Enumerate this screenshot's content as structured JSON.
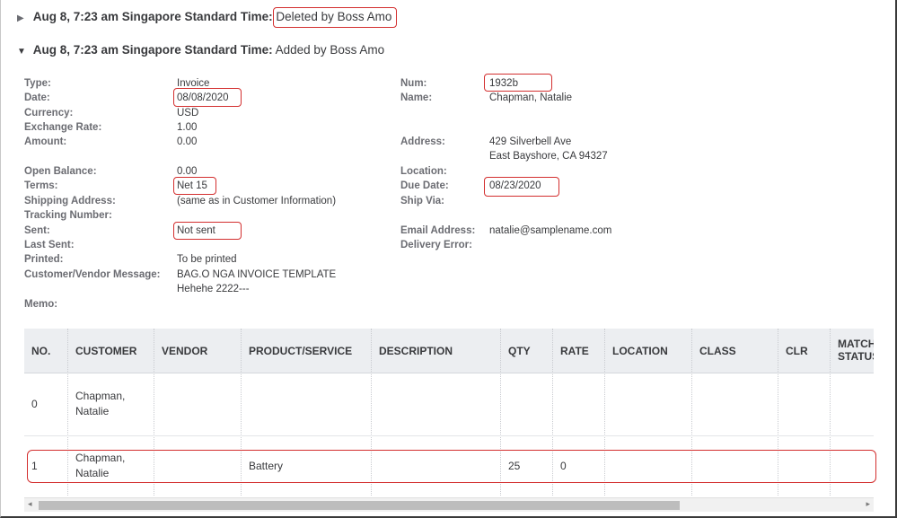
{
  "entries": [
    {
      "toggle": "▶",
      "timestamp": "Aug 8, 7:23 am Singapore Standard Time:",
      "action": "Deleted by Boss Amo"
    },
    {
      "toggle": "▼",
      "timestamp": "Aug 8, 7:23 am Singapore Standard Time:",
      "action": "Added by Boss Amo"
    }
  ],
  "details_left": [
    {
      "label": "Type:",
      "value": "Invoice"
    },
    {
      "label": "Date:",
      "value": "08/08/2020"
    },
    {
      "label": "Currency:",
      "value": "USD"
    },
    {
      "label": "Exchange Rate:",
      "value": "1.00"
    },
    {
      "label": "Amount:",
      "value": "0.00"
    },
    {
      "label": "Open Balance:",
      "value": "0.00"
    },
    {
      "label": "Terms:",
      "value": "Net 15"
    },
    {
      "label": "Shipping Address:",
      "value": "(same as in Customer Information)"
    },
    {
      "label": "Tracking Number:",
      "value": ""
    },
    {
      "label": "Sent:",
      "value": "Not sent"
    },
    {
      "label": "Last Sent:",
      "value": ""
    },
    {
      "label": "Printed:",
      "value": "To be printed"
    },
    {
      "label": "Customer/Vendor Message:",
      "value": "BAG.O NGA INVOICE TEMPLATE",
      "value2": "Hehehe 2222---"
    },
    {
      "label": "Memo:",
      "value": ""
    }
  ],
  "details_right": [
    {
      "label": "Num:",
      "value": "1932b"
    },
    {
      "label": "Name:",
      "value": "Chapman, Natalie"
    },
    {
      "label": "Address:",
      "value": "429 Silverbell Ave",
      "value2": "East Bayshore, CA  94327"
    },
    {
      "label": "Location:",
      "value": ""
    },
    {
      "label": "Due Date:",
      "value": "08/23/2020"
    },
    {
      "label": "Ship Via:",
      "value": ""
    },
    {
      "label": "Email Address:",
      "value": "natalie@samplename.com"
    },
    {
      "label": "Delivery Error:",
      "value": ""
    }
  ],
  "table": {
    "columns": [
      "NO.",
      "CUSTOMER",
      "VENDOR",
      "PRODUCT/SERVICE",
      "DESCRIPTION",
      "QTY",
      "RATE",
      "LOCATION",
      "CLASS",
      "CLR",
      "MATCH STATUS"
    ],
    "match_line1": "MATCH",
    "match_line2": "STATUS",
    "rows": [
      {
        "no": "0",
        "customer_l1": "Chapman,",
        "customer_l2": "Natalie",
        "vendor": "",
        "product": "",
        "description": "",
        "qty": "",
        "rate": "",
        "location": "",
        "class": "",
        "clr": "",
        "match": ""
      },
      {
        "no": "1",
        "customer_l1": "Chapman,",
        "customer_l2": "Natalie",
        "vendor": "",
        "product": "Battery",
        "description": "",
        "qty": "25",
        "rate": "0",
        "location": "",
        "class": "",
        "clr": "",
        "match": ""
      }
    ]
  },
  "highlight_color": "#d32f2f",
  "icons": {
    "scroll_left": "◂",
    "scroll_right": "▸"
  }
}
